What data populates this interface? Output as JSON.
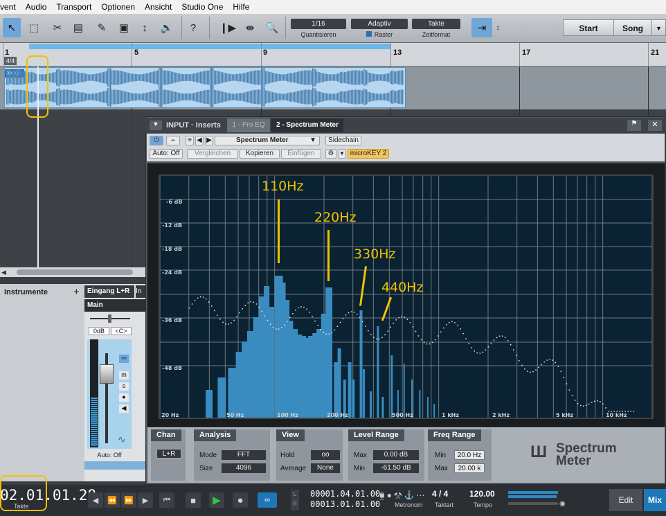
{
  "menubar": [
    "vent",
    "Audio",
    "Transport",
    "Optionen",
    "Ansicht",
    "Studio One",
    "Hilfe"
  ],
  "toolbar": {
    "quantize": {
      "value": "1/16",
      "label": "Quantisieren"
    },
    "snap": {
      "value": "Adaptiv",
      "label": "Raster"
    },
    "timebase": {
      "value": "Takte",
      "label": "Zeitformat"
    },
    "start_label": "Start",
    "song_label": "Song",
    "help_label": "?"
  },
  "ruler": {
    "marks": [
      "1",
      "5",
      "9",
      "13",
      "17",
      "21"
    ],
    "signature": "4/4"
  },
  "clip": {
    "name": "ake2"
  },
  "inserts": {
    "title": "INPUT · Inserts",
    "tab1": "1 - Pro EQ",
    "tab2": "2 - Spectrum Meter",
    "preset": "Spectrum Meter",
    "sidechain": "Sidechain",
    "auto": "Auto: Off",
    "compare": "Vergleichen",
    "copy": "Kopieren",
    "paste": "Einfügen",
    "device": "microKEY 2"
  },
  "spectrum": {
    "y_labels": [
      "-6 dB",
      "-12 dB",
      "-18 dB",
      "-24 dB",
      "-36 dB",
      "-48 dB"
    ],
    "x_labels": [
      "20 Hz",
      "50 Hz",
      "100 Hz",
      "200 Hz",
      "500 Hz",
      "1 kHz",
      "2 kHz",
      "5 kHz",
      "10 kHz"
    ],
    "annotations": [
      "110Hz",
      "220Hz",
      "330Hz",
      "440Hz"
    ],
    "annotation_color": "#f4c200",
    "bar_color": "#3a8cc0"
  },
  "controls": {
    "chan": {
      "title": "Chan",
      "value": "L+R"
    },
    "analysis": {
      "title": "Analysis",
      "mode_label": "Mode",
      "mode": "FFT",
      "size_label": "Size",
      "size": "4096"
    },
    "view": {
      "title": "View",
      "hold_label": "Hold",
      "hold": "oo",
      "average_label": "Average",
      "average": "None"
    },
    "level": {
      "title": "Level Range",
      "max_label": "Max",
      "max": "0.00 dB",
      "min_label": "Min",
      "min": "-61.50 dB"
    },
    "freq": {
      "title": "Freq Range",
      "min_label": "Min",
      "min": "20.0 Hz",
      "max_label": "Max",
      "max": "20.00 k"
    },
    "logo_line1": "Spectrum",
    "logo_line2": "Meter"
  },
  "leftpane": {
    "title": "Instrumente",
    "add": "+"
  },
  "mixer": {
    "input": "Eingang L+R",
    "bus": "Main",
    "gain": "0dB",
    "pan": "<C>",
    "auto": "Auto: Off",
    "next": "In"
  },
  "transport": {
    "time": "02.01.01.28",
    "time_label": "Takte",
    "pos1": "00001.04.01.00",
    "pos2": "00013.01.01.00",
    "sig": "4 / 4",
    "sig_label": "Taktart",
    "tempo": "120.00",
    "tempo_label": "Tempo",
    "metronome_label": "Metronom",
    "edit": "Edit",
    "mix": "Mix"
  }
}
